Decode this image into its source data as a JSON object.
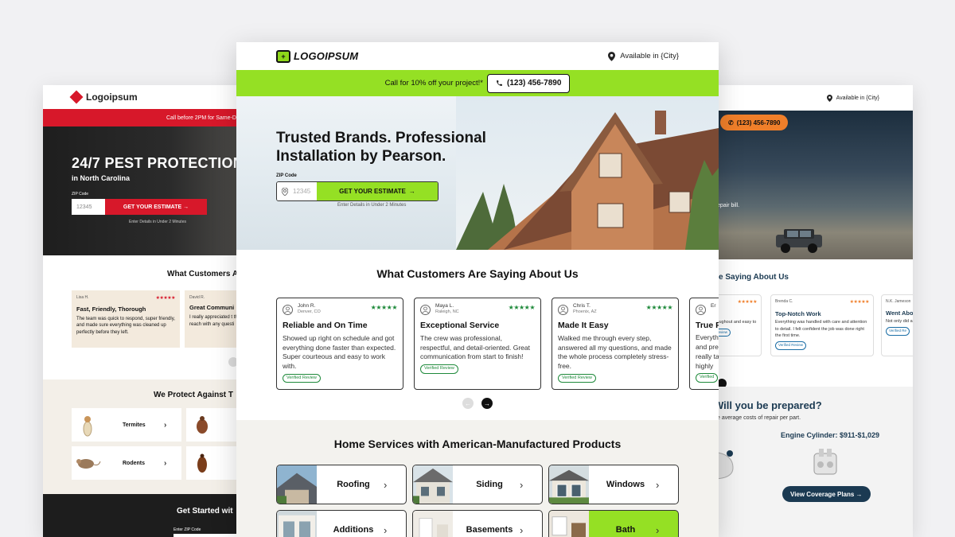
{
  "left": {
    "logo": "Logoipsum",
    "banner": "Call before 2PM for Same-Day",
    "hero_title": "24/7 PEST PROTECTION",
    "hero_sub": "in North Carolina",
    "zip_label": "ZIP Code",
    "zip_placeholder": "12345",
    "cta": "GET YOUR ESTIMATE →",
    "note": "Enter Details in Under 2 Minutes",
    "reviews_title": "What Customers A",
    "reviews": [
      {
        "name": "Lisa H.",
        "stars": "★★★★★",
        "title": "Fast, Friendly, Thorough",
        "text": "The team was quick to respond, super friendly, and made sure everything was cleaned up perfectly before they left."
      },
      {
        "name": "David R.",
        "stars": "",
        "title": "Great Communi",
        "text": "I really appreciated t the process. Clear, p reach with any questi"
      }
    ],
    "protect_title": "We Protect Against T",
    "pests": [
      {
        "label": "Termites",
        "icon": "termite-icon"
      },
      {
        "label": "",
        "icon": "bedbug-icon"
      },
      {
        "label": "Rodents",
        "icon": "mouse-icon"
      },
      {
        "label": "",
        "icon": "cockroach-icon"
      }
    ],
    "started_title": "Get Started wit",
    "started_zip_label": "Enter ZIP Code"
  },
  "center": {
    "logo": "LOGOIPSUM",
    "availability": "Available in {City}",
    "promo_text": "Call for 10% off your project!*",
    "phone": "(123) 456-7890",
    "hero_title": "Trusted Brands. Professional Installation by Pearson.",
    "zip_label": "ZIP Code",
    "zip_placeholder": "12345",
    "cta": "GET YOUR ESTIMATE",
    "note": "Enter Details in Under 2 Minutes",
    "testimonials_title": "What Customers Are Saying About Us",
    "reviews": [
      {
        "name": "John R.",
        "location": "Denver, CO",
        "stars": "★★★★★",
        "title": "Reliable and On Time",
        "text": "Showed up right on schedule and got everything done faster than expected. Super courteous and easy to work with.",
        "badge": "Verified Review"
      },
      {
        "name": "Maya L.",
        "location": "Raleigh, NC",
        "stars": "★★★★★",
        "title": "Exceptional Service",
        "text": "The crew was professional, respectful, and detail-oriented. Great communication from start to finish!",
        "badge": "Verified Review"
      },
      {
        "name": "Chris T.",
        "location": "Phoenix, AZ",
        "stars": "★★★★★",
        "title": "Made It Easy",
        "text": "Walked me through every step, answered all my questions, and made the whole process completely stress-free.",
        "badge": "Verified Review"
      },
      {
        "name": "Er",
        "location": "",
        "stars": "",
        "title": "True F",
        "text": "Everyth and pre really ta highly",
        "badge": "Verified"
      }
    ],
    "services_title": "Home Services with American-Manufactured Products",
    "services": [
      {
        "label": "Roofing",
        "active": false
      },
      {
        "label": "Siding",
        "active": false
      },
      {
        "label": "Windows",
        "active": false
      },
      {
        "label": "Additions",
        "active": false
      },
      {
        "label": "Basements",
        "active": false
      },
      {
        "label": "Bath",
        "active": true
      }
    ]
  },
  "right": {
    "availability": "Available in {City}",
    "phone": "(123) 456-7890",
    "hero_text": "epair bill.",
    "reviews_title": "e Saying About Us",
    "reviews": [
      {
        "name": "",
        "stars": "★★★★★",
        "title": "idion",
        "text": "ndled throughout and easy to",
        "badge": "Verified Review"
      },
      {
        "name": "Brenda C.",
        "stars": "★★★★★",
        "title": "Top-Notch Work",
        "text": "Everything was handled with care and attention to detail. I felt confident the job was done right the first time.",
        "badge": "Verified Review"
      },
      {
        "name": "N.K. Jameson",
        "stars": "",
        "title": "Went Abo",
        "text": "Not only did also helpe even more",
        "badge": "Verified Re"
      }
    ],
    "prepared_title": "Will you be prepared?",
    "prepared_sub": "e average costs of repair per part.",
    "engine": "Engine Cylinder: $911-$1,029",
    "cta": "View Coverage Plans →"
  }
}
